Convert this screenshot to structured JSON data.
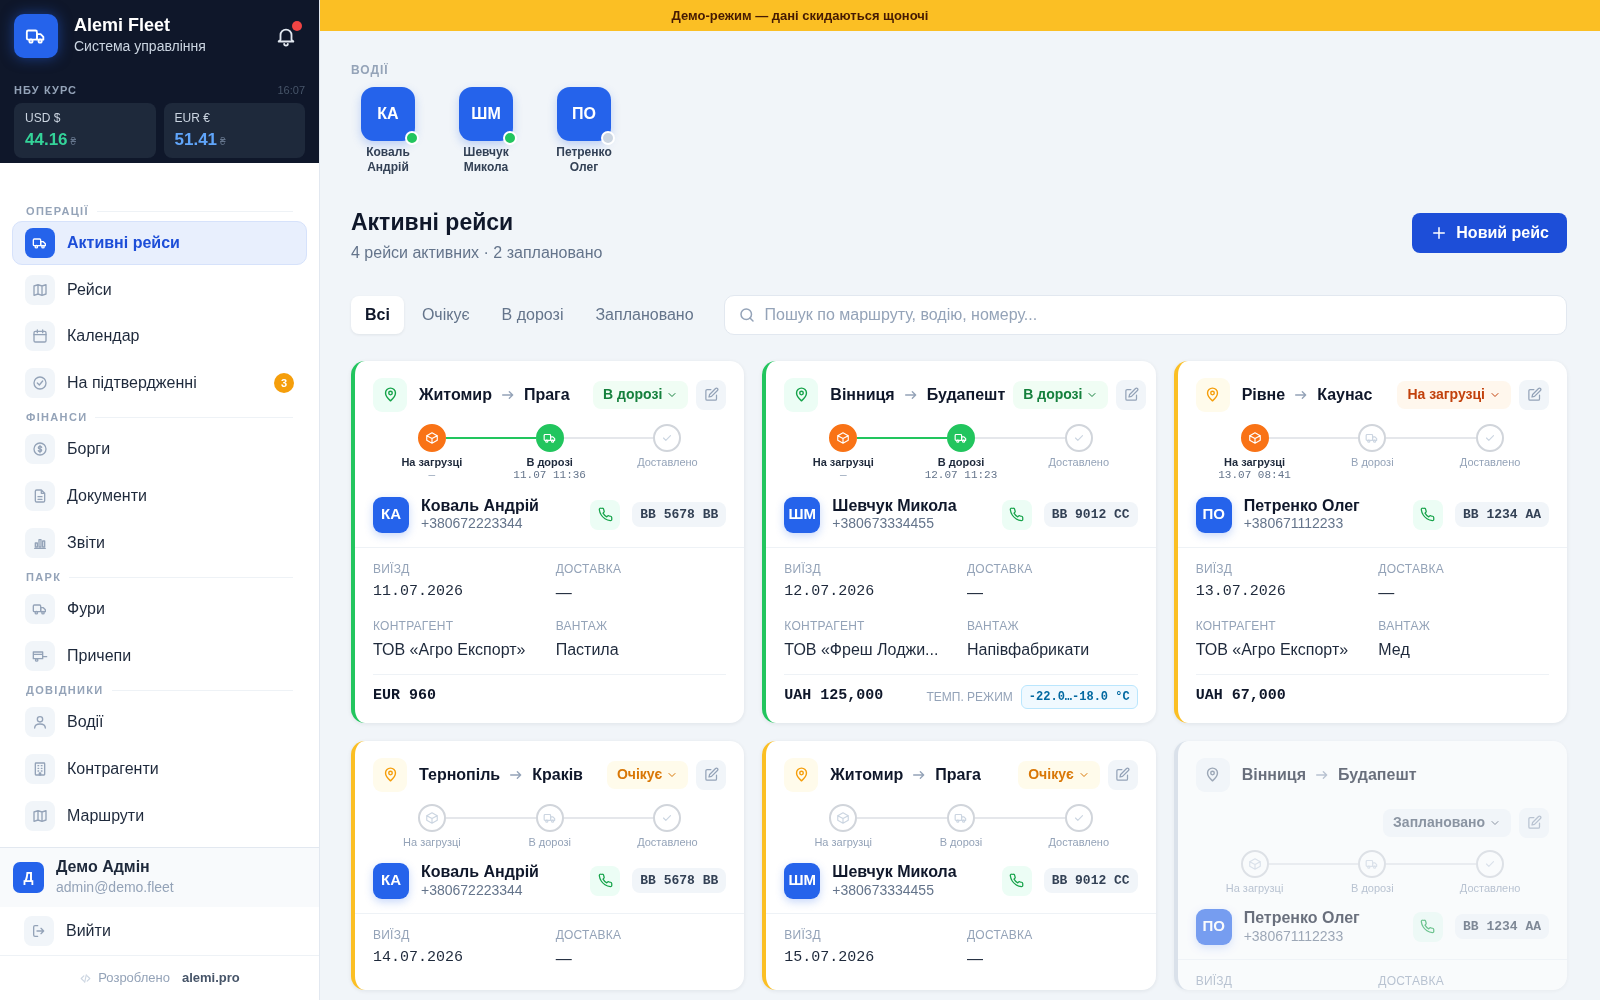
{
  "brand": {
    "name": "Alemi Fleet",
    "subtitle": "Система управління",
    "unread": true
  },
  "rates": {
    "label": "НБУ КУРС",
    "time": "16:07",
    "items": [
      {
        "label": "USD $",
        "value": "44.16",
        "unit": "₴",
        "color": "#34d399"
      },
      {
        "label": "EUR €",
        "value": "51.41",
        "unit": "₴",
        "color": "#60a5fa"
      }
    ]
  },
  "nav": {
    "sections": [
      {
        "title": "ОПЕРАЦІЇ",
        "items": [
          {
            "label": "Активні рейси",
            "selected": true
          },
          {
            "label": "Рейси",
            "selected": false
          },
          {
            "label": "Календар",
            "selected": false
          },
          {
            "label": "На підтвердженні",
            "selected": false,
            "badge": "3"
          }
        ]
      },
      {
        "title": "ФІНАНСИ",
        "items": [
          {
            "label": "Борги",
            "selected": false
          },
          {
            "label": "Документи",
            "selected": false
          },
          {
            "label": "Звіти",
            "selected": false
          }
        ]
      },
      {
        "title": "ПАРК",
        "items": [
          {
            "label": "Фури",
            "selected": false
          },
          {
            "label": "Причепи",
            "selected": false
          }
        ]
      },
      {
        "title": "ДОВІДНИКИ",
        "items": [
          {
            "label": "Водії",
            "selected": false
          },
          {
            "label": "Контрагенти",
            "selected": false
          },
          {
            "label": "Маршрути",
            "selected": false
          }
        ]
      }
    ]
  },
  "user": {
    "initials": "Д",
    "name": "Демо Адмін",
    "email": "admin@demo.fleet"
  },
  "logout": "Вийти",
  "footer": {
    "text": "Розроблено",
    "link": "alemi.pro"
  },
  "banner": "Демо-режим — дані скидаються щоночі",
  "drivers": {
    "label": "ВОДІЇ",
    "items": [
      {
        "initials": "КА",
        "name": "Коваль Андрій",
        "online": true
      },
      {
        "initials": "ШМ",
        "name": "Шевчук Микола",
        "online": true
      },
      {
        "initials": "ПО",
        "name": "Петренко Олег",
        "online": false
      }
    ]
  },
  "heading": {
    "title": "Активні рейси",
    "subtitle": "4 рейси активних · 2 заплановано",
    "new_button": "Новий рейс"
  },
  "filters": {
    "tabs": [
      {
        "label": "Всі",
        "selected": true
      },
      {
        "label": "Очікує",
        "selected": false
      },
      {
        "label": "В дорозі",
        "selected": false
      },
      {
        "label": "Заплановано",
        "selected": false
      }
    ],
    "placeholder": "Пошук по маршруту, водію, номеру..."
  },
  "trips": [
    {
      "status": {
        "kind": "road",
        "label": "В дорозі"
      },
      "from": "Житомир",
      "to": "Прага",
      "steps": [
        {
          "kind": "loading",
          "label": "На загрузці",
          "reached": true,
          "time": "—"
        },
        {
          "kind": "road",
          "label": "В дорозі",
          "reached": true,
          "time": "11.07 11:36"
        },
        {
          "kind": "delivered",
          "label": "Доставлено",
          "reached": false
        }
      ],
      "driver": {
        "initials": "КА",
        "name": "Коваль Андрій",
        "phone": "+380672223344"
      },
      "plate": "ВВ 5678 ВВ",
      "fields": [
        {
          "kind": "date",
          "label": "ВИЇЗД",
          "value": "11.07.2026"
        },
        {
          "kind": "text",
          "label": "ДОСТАВКА",
          "value": "—"
        },
        {
          "kind": "text",
          "label": "КОНТРАГЕНТ",
          "value": "ТОВ «Агро Експорт»"
        },
        {
          "kind": "text",
          "label": "ВАНТАЖ",
          "value": "Пастила"
        }
      ],
      "price": "EUR 960"
    },
    {
      "status": {
        "kind": "road",
        "label": "В дорозі"
      },
      "from": "Вінниця",
      "to": "Будапешт",
      "steps": [
        {
          "kind": "loading",
          "label": "На загрузці",
          "reached": true,
          "time": "—"
        },
        {
          "kind": "road",
          "label": "В дорозі",
          "reached": true,
          "time": "12.07 11:23"
        },
        {
          "kind": "delivered",
          "label": "Доставлено",
          "reached": false
        }
      ],
      "driver": {
        "initials": "ШМ",
        "name": "Шевчук Микола",
        "phone": "+380673334455"
      },
      "plate": "ВВ 9012 СС",
      "fields": [
        {
          "kind": "date",
          "label": "ВИЇЗД",
          "value": "12.07.2026"
        },
        {
          "kind": "text",
          "label": "ДОСТАВКА",
          "value": "—"
        },
        {
          "kind": "text",
          "label": "КОНТРАГЕНТ",
          "value": "ТОВ «Фреш Лоджи..."
        },
        {
          "kind": "text",
          "label": "ВАНТАЖ",
          "value": "Напівфабрикати"
        }
      ],
      "price": "UAH 125,000",
      "temp": {
        "label": "ТЕМП. РЕЖИМ",
        "value": "-22.0…-18.0 °C"
      }
    },
    {
      "status": {
        "kind": "loading",
        "label": "На загрузці"
      },
      "from": "Рівне",
      "to": "Каунас",
      "steps": [
        {
          "kind": "loading",
          "label": "На загрузці",
          "reached": true,
          "time": "13.07 08:41"
        },
        {
          "kind": "road",
          "label": "В дорозі",
          "reached": false
        },
        {
          "kind": "delivered",
          "label": "Доставлено",
          "reached": false
        }
      ],
      "driver": {
        "initials": "ПО",
        "name": "Петренко Олег",
        "phone": "+380671112233"
      },
      "plate": "ВВ 1234 АА",
      "fields": [
        {
          "kind": "date",
          "label": "ВИЇЗД",
          "value": "13.07.2026"
        },
        {
          "kind": "text",
          "label": "ДОСТАВКА",
          "value": "—"
        },
        {
          "kind": "text",
          "label": "КОНТРАГЕНТ",
          "value": "ТОВ «Агро Експорт»"
        },
        {
          "kind": "text",
          "label": "ВАНТАЖ",
          "value": "Мед"
        }
      ],
      "price": "UAH 67,000"
    },
    {
      "status": {
        "kind": "pending",
        "label": "Очікує"
      },
      "from": "Тернопіль",
      "to": "Краків",
      "steps": [
        {
          "kind": "loading",
          "label": "На загрузці",
          "reached": false
        },
        {
          "kind": "road",
          "label": "В дорозі",
          "reached": false
        },
        {
          "kind": "delivered",
          "label": "Доставлено",
          "reached": false
        }
      ],
      "driver": {
        "initials": "КА",
        "name": "Коваль Андрій",
        "phone": "+380672223344"
      },
      "plate": "ВВ 5678 ВВ",
      "fields": [
        {
          "kind": "date",
          "label": "ВИЇЗД",
          "value": "14.07.2026"
        },
        {
          "kind": "text",
          "label": "ДОСТАВКА",
          "value": "—"
        }
      ]
    },
    {
      "status": {
        "kind": "pending",
        "label": "Очікує"
      },
      "from": "Житомир",
      "to": "Прага",
      "steps": [
        {
          "kind": "loading",
          "label": "На загрузці",
          "reached": false
        },
        {
          "kind": "road",
          "label": "В дорозі",
          "reached": false
        },
        {
          "kind": "delivered",
          "label": "Доставлено",
          "reached": false
        }
      ],
      "driver": {
        "initials": "ШМ",
        "name": "Шевчук Микола",
        "phone": "+380673334455"
      },
      "plate": "ВВ 9012 СС",
      "fields": [
        {
          "kind": "date",
          "label": "ВИЇЗД",
          "value": "15.07.2026"
        },
        {
          "kind": "text",
          "label": "ДОСТАВКА",
          "value": "—"
        }
      ]
    },
    {
      "status": {
        "kind": "planned",
        "label": "Заплановано"
      },
      "from": "Вінниця",
      "to": "Будапешт",
      "steps": [
        {
          "kind": "loading",
          "label": "На загрузці",
          "reached": false
        },
        {
          "kind": "road",
          "label": "В дорозі",
          "reached": false
        },
        {
          "kind": "delivered",
          "label": "Доставлено",
          "reached": false
        }
      ],
      "driver": {
        "initials": "ПО",
        "name": "Петренко Олег",
        "phone": "+380671112233"
      },
      "plate": "ВВ 1234 АА",
      "fields": [
        {
          "label": "ВИЇЗД"
        },
        {
          "label": "ДОСТАВКА"
        }
      ]
    }
  ]
}
